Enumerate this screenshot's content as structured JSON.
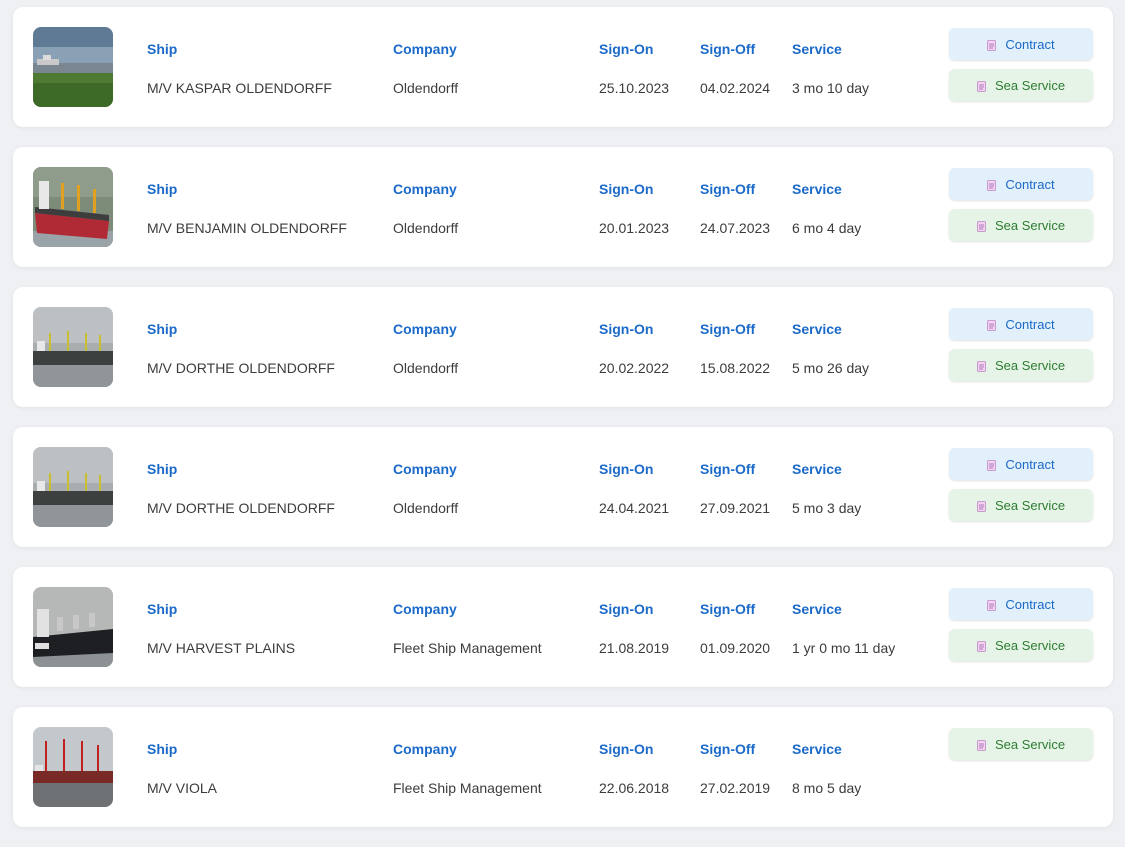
{
  "labels": {
    "ship": "Ship",
    "company": "Company",
    "sign_on": "Sign-On",
    "sign_off": "Sign-Off",
    "service": "Service",
    "contract_button": "Contract",
    "sea_service_button": "Sea Service"
  },
  "colors": {
    "label_blue": "#1b6ac9",
    "contract_bg": "#e2f0fc",
    "sea_service_bg": "#e5f4e6",
    "sea_service_text": "#2e7d32"
  },
  "records": [
    {
      "ship": "M/V KASPAR OLDENDORFF",
      "company": "Oldendorff",
      "sign_on": "25.10.2023",
      "sign_off": "04.02.2024",
      "service": "3 mo 10 day",
      "has_contract": true,
      "photo": "ship-photo-icon"
    },
    {
      "ship": "M/V BENJAMIN OLDENDORFF",
      "company": "Oldendorff",
      "sign_on": "20.01.2023",
      "sign_off": "24.07.2023",
      "service": "6 mo 4 day",
      "has_contract": true,
      "photo": "ship-photo-icon"
    },
    {
      "ship": "M/V DORTHE OLDENDORFF",
      "company": "Oldendorff",
      "sign_on": "20.02.2022",
      "sign_off": "15.08.2022",
      "service": "5 mo 26 day",
      "has_contract": true,
      "photo": "ship-photo-icon"
    },
    {
      "ship": "M/V DORTHE OLDENDORFF",
      "company": "Oldendorff",
      "sign_on": "24.04.2021",
      "sign_off": "27.09.2021",
      "service": "5 mo 3 day",
      "has_contract": true,
      "photo": "ship-photo-icon"
    },
    {
      "ship": "M/V HARVEST PLAINS",
      "company": "Fleet Ship Management",
      "sign_on": "21.08.2019",
      "sign_off": "01.09.2020",
      "service": "1 yr 0 mo 11 day",
      "has_contract": true,
      "photo": "ship-photo-icon"
    },
    {
      "ship": "M/V VIOLA",
      "company": "Fleet Ship Management",
      "sign_on": "22.06.2018",
      "sign_off": "27.02.2019",
      "service": "8 mo 5 day",
      "has_contract": false,
      "photo": "ship-photo-icon"
    }
  ]
}
